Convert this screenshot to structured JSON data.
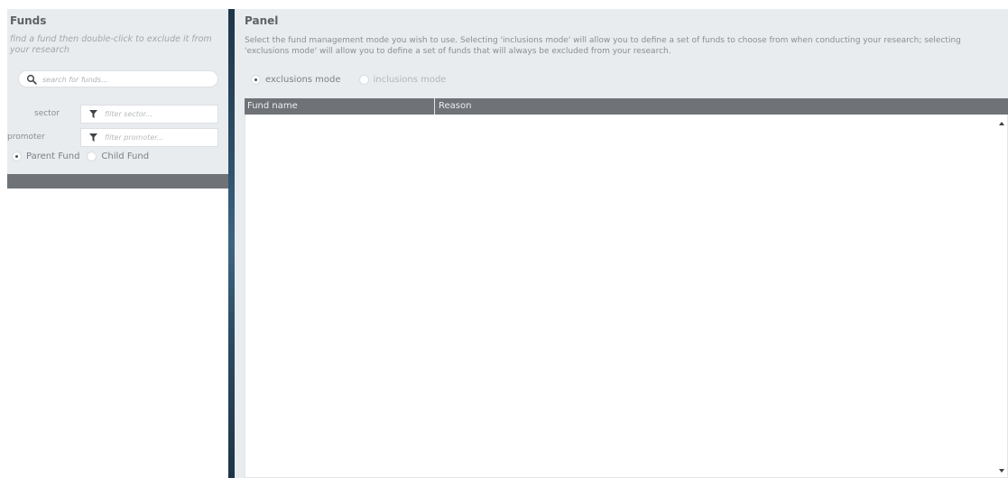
{
  "funds_panel": {
    "title": "Funds",
    "hint": "find a fund then double-click to exclude it from your research",
    "search": {
      "placeholder": "search for funds...",
      "value": ""
    },
    "sector": {
      "label": "sector",
      "placeholder": "filter sector...",
      "value": ""
    },
    "promoter": {
      "label": "promoter",
      "placeholder": "filter promoter...",
      "value": ""
    },
    "fund_type": {
      "options": [
        "Parent Fund",
        "Child Fund"
      ],
      "selected": "Parent Fund"
    }
  },
  "panel": {
    "title": "Panel",
    "description": "Select the fund management mode you wish to use. Selecting 'inclusions mode' will allow you to define a set of funds to choose from when conducting your research; selecting 'exclusions mode' will allow you to define a set of funds that will always be excluded from your research.",
    "modes": {
      "options": [
        "exclusions mode",
        "inclusions mode"
      ],
      "selected": "exclusions mode"
    },
    "table": {
      "columns": [
        "Fund name",
        "Reason"
      ],
      "rows": []
    }
  },
  "icons": {
    "search": "search-icon",
    "filter": "filter-icon",
    "scroll_up": "scroll-up-arrow-icon",
    "scroll_down": "scroll-down-arrow-icon"
  },
  "colors": {
    "header_bar": "#6f7377",
    "panel_bg": "#e9ecef",
    "divider": "#2d4d66"
  }
}
